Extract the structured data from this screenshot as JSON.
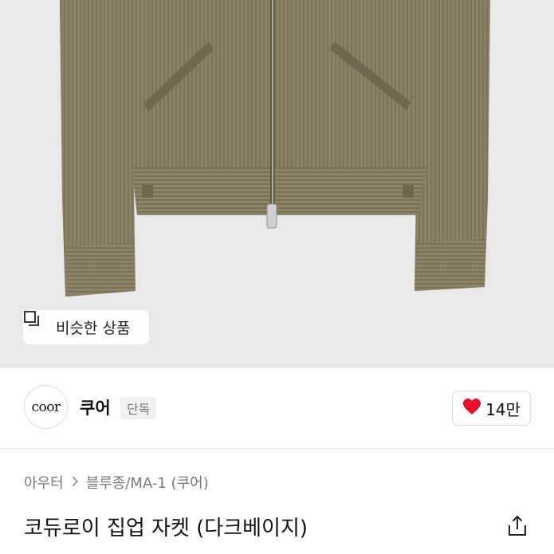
{
  "hero": {
    "similar_button_label": "비슷한 상품",
    "similar_icon": "similar-items-icon"
  },
  "brand": {
    "logo_text": "coor",
    "name": "쿠어",
    "badge": "단독",
    "like_icon": "heart-icon",
    "like_count": "14만",
    "like_color": "#e8112d"
  },
  "breadcrumb": {
    "items": [
      "아우터",
      "블루종/MA-1 (쿠어)"
    ],
    "separator": ">"
  },
  "product": {
    "title": "코듀로이 집업 자켓 (다크베이지)",
    "share_icon": "share-icon"
  }
}
